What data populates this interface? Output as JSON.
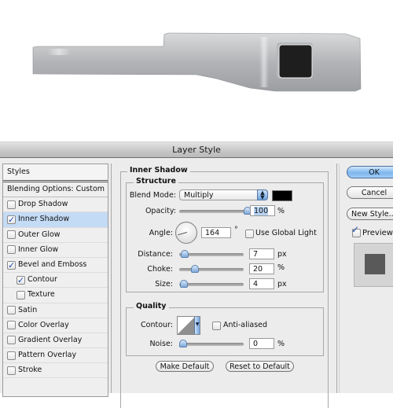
{
  "dialog": {
    "title": "Layer Style"
  },
  "styles_panel": {
    "header": "Styles",
    "items": [
      {
        "label": "Blending Options: Custom",
        "checkbox": false,
        "checked": false,
        "selected": false,
        "sub": false
      },
      {
        "label": "Drop Shadow",
        "checkbox": true,
        "checked": false,
        "selected": false,
        "sub": false
      },
      {
        "label": "Inner Shadow",
        "checkbox": true,
        "checked": true,
        "selected": true,
        "sub": false
      },
      {
        "label": "Outer Glow",
        "checkbox": true,
        "checked": false,
        "selected": false,
        "sub": false
      },
      {
        "label": "Inner Glow",
        "checkbox": true,
        "checked": false,
        "selected": false,
        "sub": false
      },
      {
        "label": "Bevel and Emboss",
        "checkbox": true,
        "checked": true,
        "selected": false,
        "sub": false
      },
      {
        "label": "Contour",
        "checkbox": true,
        "checked": true,
        "selected": false,
        "sub": true
      },
      {
        "label": "Texture",
        "checkbox": true,
        "checked": false,
        "selected": false,
        "sub": true
      },
      {
        "label": "Satin",
        "checkbox": true,
        "checked": false,
        "selected": false,
        "sub": false
      },
      {
        "label": "Color Overlay",
        "checkbox": true,
        "checked": false,
        "selected": false,
        "sub": false
      },
      {
        "label": "Gradient Overlay",
        "checkbox": true,
        "checked": false,
        "selected": false,
        "sub": false
      },
      {
        "label": "Pattern Overlay",
        "checkbox": true,
        "checked": false,
        "selected": false,
        "sub": false
      },
      {
        "label": "Stroke",
        "checkbox": true,
        "checked": false,
        "selected": false,
        "sub": false
      }
    ]
  },
  "inner_shadow": {
    "section_title": "Inner Shadow",
    "structure": {
      "title": "Structure",
      "blend_mode_label": "Blend Mode:",
      "blend_mode_value": "Multiply",
      "shadow_color": "#000000",
      "opacity_label": "Opacity:",
      "opacity_value": "100",
      "opacity_unit": "%",
      "opacity_fraction": 1.0,
      "angle_label": "Angle:",
      "angle_value": "164",
      "angle_unit": "°",
      "use_global_light_label": "Use Global Light",
      "use_global_light_checked": false,
      "distance_label": "Distance:",
      "distance_value": "7",
      "distance_unit": "px",
      "distance_fraction": 0.03,
      "choke_label": "Choke:",
      "choke_value": "20",
      "choke_unit": "%",
      "choke_fraction": 0.2,
      "size_label": "Size:",
      "size_value": "4",
      "size_unit": "px",
      "size_fraction": 0.02
    },
    "quality": {
      "title": "Quality",
      "contour_label": "Contour:",
      "anti_aliased_label": "Anti-aliased",
      "anti_aliased_checked": false,
      "noise_label": "Noise:",
      "noise_value": "0",
      "noise_unit": "%",
      "noise_fraction": 0.0
    },
    "make_default_label": "Make Default",
    "reset_default_label": "Reset to Default"
  },
  "buttons": {
    "ok_label": "OK",
    "cancel_label": "Cancel",
    "new_style_label": "New Style...",
    "preview_label": "Preview",
    "preview_checked": true
  },
  "colors": {
    "accent": "#7db6ee",
    "selection": "#c4dbf5",
    "preview_swatch": "#595959",
    "dialog_bg": "#ececec"
  }
}
